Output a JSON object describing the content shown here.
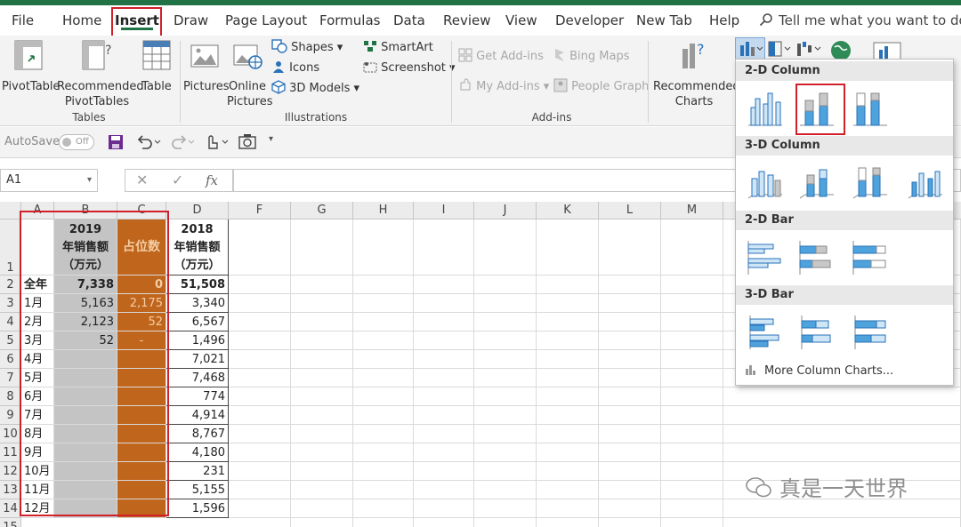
{
  "ribbon_tabs": [
    "File",
    "Home",
    "Insert",
    "Draw",
    "Page Layout",
    "Formulas",
    "Data",
    "Review",
    "View",
    "Developer",
    "New Tab",
    "Help"
  ],
  "tell_me": "Tell me what you want to do",
  "ribbon": {
    "pivottable": "PivotTable",
    "recommended_pivot_1": "Recommended",
    "recommended_pivot_2": "PivotTables",
    "table": "Table",
    "tables_group": "Tables",
    "pictures": "Pictures",
    "online_pictures_1": "Online",
    "online_pictures_2": "Pictures",
    "shapes": "Shapes",
    "icons": "Icons",
    "models_3d": "3D Models",
    "smartart": "SmartArt",
    "screenshot": "Screenshot",
    "illustrations_group": "Illustrations",
    "get_addins": "Get Add-ins",
    "my_addins": "My Add-ins",
    "bing_maps": "Bing Maps",
    "people_graph": "People Graph",
    "addins_group": "Add-ins",
    "recommended_charts_1": "Recommended",
    "recommended_charts_2": "Charts"
  },
  "qat": {
    "autosave": "AutoSave",
    "toggle": "Off"
  },
  "formula_bar": {
    "name_box": "A1",
    "fx": "fx",
    "value": ""
  },
  "columns": [
    "A",
    "B",
    "C",
    "D",
    "F",
    "G",
    "H",
    "I",
    "J",
    "K",
    "L",
    "M"
  ],
  "rows": [
    "1",
    "2",
    "3",
    "4",
    "5",
    "6",
    "7",
    "8",
    "9",
    "10",
    "11",
    "12",
    "13",
    "14",
    "15"
  ],
  "header_row": {
    "b": [
      "2019",
      "年销售额",
      "（万元）"
    ],
    "c": "占位数",
    "d": [
      "2018",
      "年销售额",
      "（万元）"
    ]
  },
  "data_rows": [
    {
      "a": "全年",
      "b": "7,338",
      "c": "0",
      "d": "51,508"
    },
    {
      "a": "1月",
      "b": "5,163",
      "c": "2,175",
      "d": "3,340"
    },
    {
      "a": "2月",
      "b": "2,123",
      "c": "52",
      "d": "6,567"
    },
    {
      "a": "3月",
      "b": "52",
      "c": "-",
      "d": "1,496"
    },
    {
      "a": "4月",
      "b": "",
      "c": "",
      "d": "7,021"
    },
    {
      "a": "5月",
      "b": "",
      "c": "",
      "d": "7,468"
    },
    {
      "a": "6月",
      "b": "",
      "c": "",
      "d": "774"
    },
    {
      "a": "7月",
      "b": "",
      "c": "",
      "d": "4,914"
    },
    {
      "a": "8月",
      "b": "",
      "c": "",
      "d": "8,767"
    },
    {
      "a": "9月",
      "b": "",
      "c": "",
      "d": "4,180"
    },
    {
      "a": "10月",
      "b": "",
      "c": "",
      "d": "231"
    },
    {
      "a": "11月",
      "b": "",
      "c": "",
      "d": "5,155"
    },
    {
      "a": "12月",
      "b": "",
      "c": "",
      "d": "1,596"
    }
  ],
  "chart_menu": {
    "sections": [
      "2-D Column",
      "3-D Column",
      "2-D Bar",
      "3-D Bar"
    ],
    "more": "More Column Charts..."
  },
  "watermark": "真是一天世界",
  "colors": {
    "excel_green": "#217346",
    "highlight_red": "#d0202a",
    "orange_fill": "#c0651c",
    "gray_fill": "#c4c4c4",
    "chart_blue": "#4fa3dc"
  }
}
